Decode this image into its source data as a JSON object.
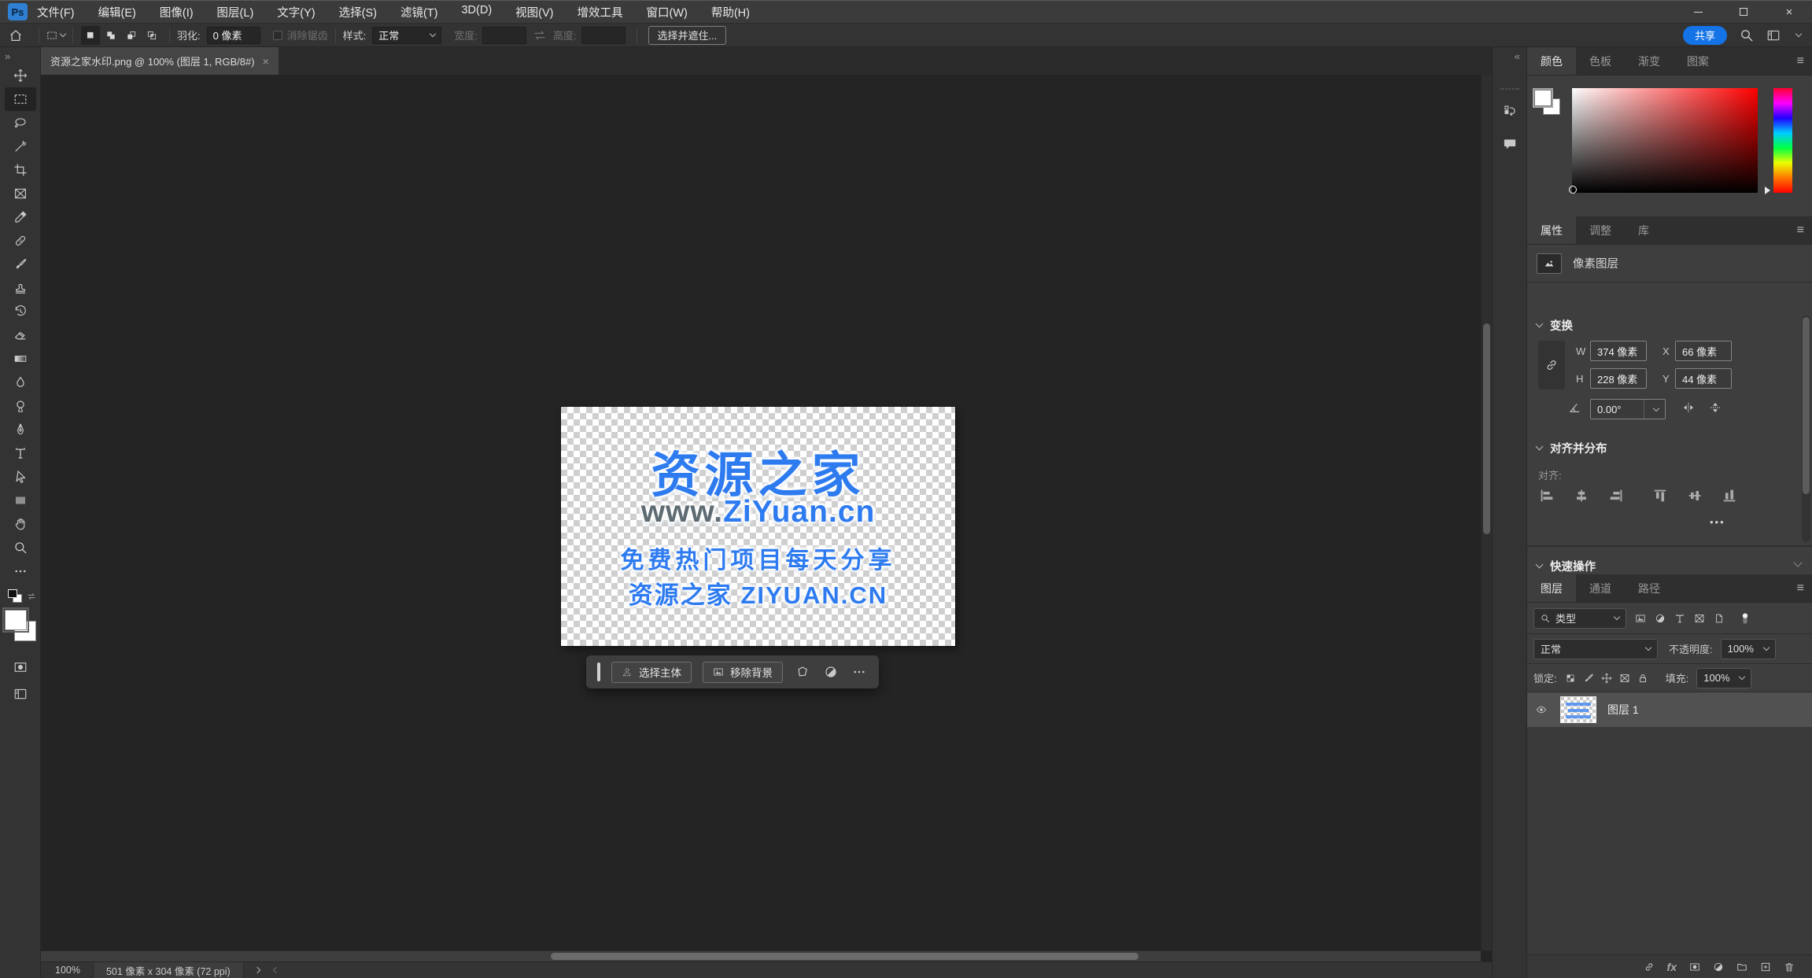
{
  "chrome": {
    "logo": "Ps",
    "menus": [
      "文件(F)",
      "编辑(E)",
      "图像(I)",
      "图层(L)",
      "文字(Y)",
      "选择(S)",
      "滤镜(T)",
      "3D(D)",
      "视图(V)",
      "增效工具",
      "窗口(W)",
      "帮助(H)"
    ],
    "close": "×"
  },
  "glyphs": {
    "collapse_left": "«",
    "collapse_right": "»",
    "panel_menu": "≡",
    "ellipsis": "•••",
    "fx": "fx"
  },
  "options": {
    "feather_label": "羽化:",
    "feather_value": "0 像素",
    "antialias_label": "消除锯齿",
    "style_label": "样式:",
    "style_value": "正常",
    "width_label": "宽度:",
    "width_value": "",
    "height_label": "高度:",
    "height_value": "",
    "select_and_mask": "选择并遮住...",
    "share": "共享"
  },
  "document_tab": {
    "title": "资源之家水印.png @ 100% (图层 1, RGB/8#)",
    "close": "×"
  },
  "toolbar": {
    "active_tool": "rectangular-marquee",
    "tools": [
      "move",
      "rectangular-marquee",
      "lasso",
      "magic-wand",
      "crop",
      "frame",
      "eyedropper",
      "spot-healing-brush",
      "brush",
      "clone-stamp",
      "history-brush",
      "eraser",
      "gradient",
      "blur",
      "dodge",
      "pen",
      "type",
      "path-selection",
      "rectangle",
      "hand",
      "zoom",
      "edit-toolbar"
    ]
  },
  "artboard": {
    "width_px": "501",
    "height_px": "304",
    "line1": "资源之家",
    "line2_gray": "www.",
    "line2_blue": "ZiYuan.cn",
    "line3": "免费热门项目每天分享",
    "line4": "资源之家 ZIYUAN.CN",
    "colors": {
      "blue": "#2e7bf0",
      "gray": "#5f6b73",
      "green_accent": "#1fc27c"
    }
  },
  "taskbar": {
    "select_subject": "选择主体",
    "remove_background": "移除背景"
  },
  "color_panel": {
    "tabs": [
      "颜色",
      "色板",
      "渐变",
      "图案"
    ],
    "active_tab": "颜色"
  },
  "properties_panel": {
    "tabs": [
      "属性",
      "调整",
      "库"
    ],
    "active_tab": "属性",
    "layer_kind": "像素图层",
    "transform_title": "变换",
    "w_label": "W",
    "w_value": "374 像素",
    "x_label": "X",
    "x_value": "66 像素",
    "h_label": "H",
    "h_value": "228 像素",
    "y_label": "Y",
    "y_value": "44 像素",
    "angle_value": "0.00°",
    "align_title": "对齐并分布",
    "align_label": "对齐:",
    "quick_title": "快速操作"
  },
  "layers_panel": {
    "tabs": [
      "图层",
      "通道",
      "路径"
    ],
    "active_tab": "图层",
    "filter_value": "类型",
    "blend_value": "正常",
    "opacity_label": "不透明度:",
    "opacity_value": "100%",
    "lock_label": "锁定:",
    "fill_label": "填充:",
    "fill_value": "100%",
    "layers": [
      {
        "name": "图层 1"
      }
    ]
  },
  "status_bar": {
    "zoom": "100%",
    "doc_size": "501 像素 x 304 像素 (72 ppi)"
  }
}
